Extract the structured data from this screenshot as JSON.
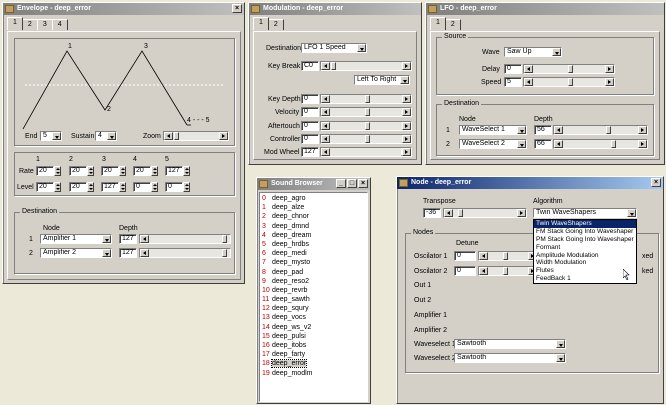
{
  "envelope": {
    "title": "Envelope - deep_error",
    "tabs": [
      "1",
      "2",
      "3",
      "4"
    ],
    "node_labels": [
      "1",
      "2",
      "3",
      "4",
      "5"
    ],
    "loop_marker": "4 - - - 5",
    "end_label": "End",
    "end_value": "5",
    "sustain_label": "Sustain",
    "sustain_value": "4",
    "zoom_label": "Zoom",
    "col_headers": [
      "1",
      "2",
      "3",
      "4",
      "5"
    ],
    "rate_label": "Rate",
    "rate_values": [
      "20",
      "20",
      "20",
      "20",
      "127"
    ],
    "level_label": "Level",
    "level_values": [
      "20",
      "20",
      "127",
      "0",
      "0"
    ],
    "dest_group": "Destination",
    "node_header": "Node",
    "depth_header": "Depth",
    "dest_rows": [
      {
        "idx": "1",
        "node": "Amplifier 1",
        "depth": "127"
      },
      {
        "idx": "2",
        "node": "Amplifier 2",
        "depth": "127"
      }
    ]
  },
  "modulation": {
    "title": "Modulation - deep_error",
    "tabs": [
      "1",
      "2"
    ],
    "destination_label": "Destination",
    "destination_value": "LFO 1 Speed",
    "keybreak_label": "Key Break",
    "keybreak_value": "C0",
    "direction_value": "Left To Right",
    "rows": [
      {
        "label": "Key Depth",
        "value": "0"
      },
      {
        "label": "Velocity",
        "value": "0"
      },
      {
        "label": "Aftertouch",
        "value": "0"
      },
      {
        "label": "Controller",
        "value": "0"
      },
      {
        "label": "Mod Wheel",
        "value": "127"
      }
    ]
  },
  "lfo": {
    "title": "LFO - deep_error",
    "tabs": [
      "1",
      "2"
    ],
    "source_group": "Source",
    "wave_label": "Wave",
    "wave_value": "Saw Up",
    "delay_label": "Delay",
    "delay_value": "0",
    "speed_label": "Speed",
    "speed_value": "5",
    "dest_group": "Destination",
    "node_header": "Node",
    "depth_header": "Depth",
    "dest_rows": [
      {
        "idx": "1",
        "node": "WaveSelect 1",
        "depth": "56"
      },
      {
        "idx": "2",
        "node": "WaveSelect 2",
        "depth": "66"
      }
    ]
  },
  "browser": {
    "title": "Sound Browser",
    "items": [
      {
        "num": "0",
        "name": "deep_agro"
      },
      {
        "num": "1",
        "name": "deep_alze"
      },
      {
        "num": "2",
        "name": "deep_chnor"
      },
      {
        "num": "3",
        "name": "deep_dmnd"
      },
      {
        "num": "4",
        "name": "deep_dream"
      },
      {
        "num": "5",
        "name": "deep_hrdbs"
      },
      {
        "num": "6",
        "name": "deep_medi"
      },
      {
        "num": "7",
        "name": "deep_mysto"
      },
      {
        "num": "8",
        "name": "deep_pad"
      },
      {
        "num": "9",
        "name": "deep_reso2"
      },
      {
        "num": "10",
        "name": "deep_revrb"
      },
      {
        "num": "11",
        "name": "deep_sawth"
      },
      {
        "num": "12",
        "name": "deep_squry"
      },
      {
        "num": "13",
        "name": "deep_vocs"
      },
      {
        "num": "14",
        "name": "deep_ws_v2"
      },
      {
        "num": "15",
        "name": "deep_pulsi"
      },
      {
        "num": "16",
        "name": "deep_itobs"
      },
      {
        "num": "17",
        "name": "deep_farty"
      },
      {
        "num": "18",
        "name": "deep_error"
      },
      {
        "num": "19",
        "name": "deep_modlm"
      }
    ],
    "selected_index": 18
  },
  "node": {
    "title": "Node - deep_error",
    "transpose_label": "Transpose",
    "transpose_value": "-36",
    "algorithm_label": "Algorithm",
    "algorithm_value": "Twin WaveShapers",
    "algorithm_options": [
      "Twin WaveShapers",
      "FM Stack Going Into Waveshaper",
      "PM Stack Going Into Waveshaper",
      "Formant",
      "Amplitude Modulation",
      "Width Modulation",
      "Flutes",
      "FeedBack 1"
    ],
    "nodes_group": "Nodes",
    "detune_header": "Detune",
    "osc_rows": [
      {
        "label": "Oscilator 1",
        "value": "0"
      },
      {
        "label": "Oscilator 2",
        "value": "0"
      }
    ],
    "plain_rows": [
      "Out 1",
      "Out 2",
      "Amplifier 1",
      "Amplifier 2"
    ],
    "side_labels": [
      "xed",
      "ked"
    ],
    "waveselect_rows": [
      {
        "label": "Waveselect 1",
        "value": "Sawtooth"
      },
      {
        "label": "Waveselect 2",
        "value": "Sawtooth"
      }
    ]
  }
}
